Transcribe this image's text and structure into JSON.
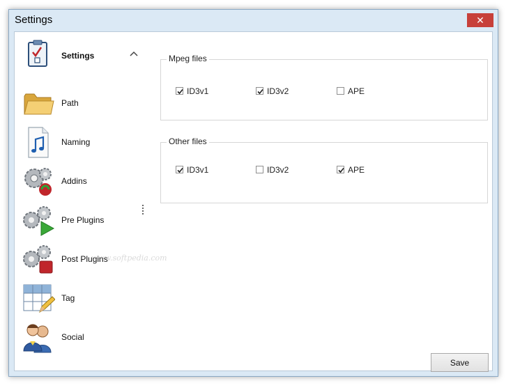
{
  "window": {
    "title": "Settings",
    "close_glyph": "✕"
  },
  "sidebar": {
    "header": {
      "label": "Settings",
      "icon": "clipboard-check-icon",
      "collapse_icon": "chevron-up-icon"
    },
    "items": [
      {
        "label": "Path",
        "icon": "folder-icon"
      },
      {
        "label": "Naming",
        "icon": "music-file-icon"
      },
      {
        "label": "Addins",
        "icon": "gears-addins-icon"
      },
      {
        "label": "Pre Plugins",
        "icon": "gears-play-icon"
      },
      {
        "label": "Post Plugins",
        "icon": "gears-stop-icon"
      },
      {
        "label": "Tag",
        "icon": "grid-pencil-icon"
      },
      {
        "label": "Social",
        "icon": "users-icon"
      }
    ]
  },
  "mpeg": {
    "title": "Mpeg files",
    "options": [
      {
        "label": "ID3v1",
        "checked": true
      },
      {
        "label": "ID3v2",
        "checked": true
      },
      {
        "label": "APE",
        "checked": false
      }
    ]
  },
  "other": {
    "title": "Other files",
    "options": [
      {
        "label": "ID3v1",
        "checked": true
      },
      {
        "label": "ID3v2",
        "checked": false
      },
      {
        "label": "APE",
        "checked": true
      }
    ]
  },
  "footer": {
    "save_label": "Save"
  },
  "watermark": "www.softpedia.com",
  "colors": {
    "close_button": "#c7403a",
    "frame": "#dbe9f5"
  }
}
